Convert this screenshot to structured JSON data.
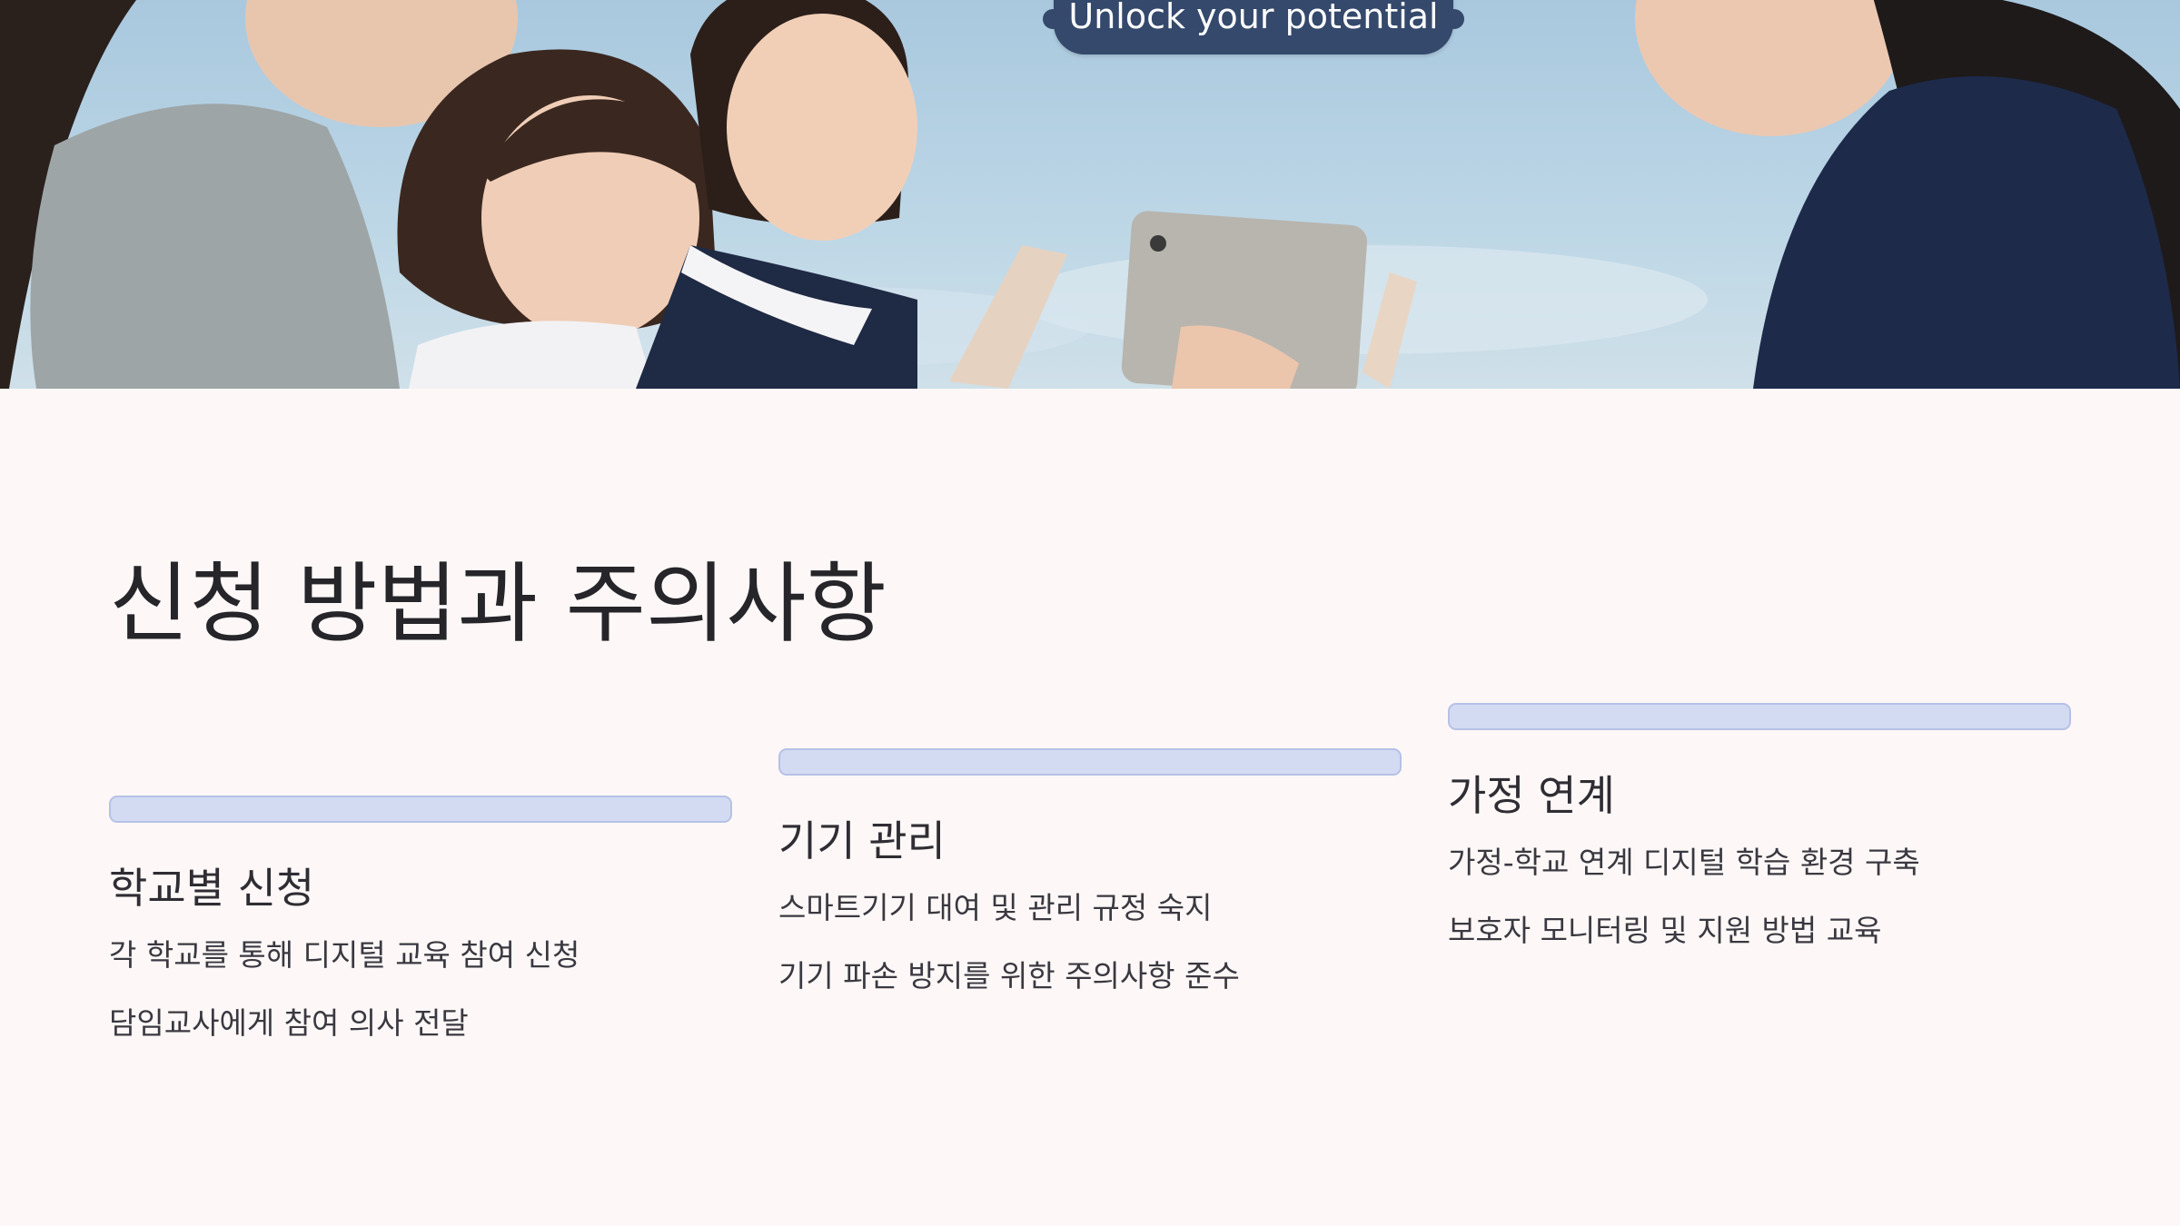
{
  "hero": {
    "badge_text": "Unlock your potential"
  },
  "slide": {
    "title": "신청 방법과 주의사항"
  },
  "cards": [
    {
      "heading": "학교별 신청",
      "lines": [
        "각 학교를 통해 디지털 교육 참여 신청",
        "담임교사에게 참여 의사 전달"
      ]
    },
    {
      "heading": "기기 관리",
      "lines": [
        "스마트기기 대여 및 관리 규정 숙지",
        "기기 파손 방지를 위한 주의사항 준수"
      ]
    },
    {
      "heading": "가정 연계",
      "lines": [
        "가정-학교 연계 디지털 학습 환경 구축",
        "보호자 모니터링 및 지원 방법 교육"
      ]
    }
  ],
  "colors": {
    "background": "#fdf8f7",
    "accent_bar": "#d3dbf3",
    "badge": "#34496b",
    "text": "#2b2a2e"
  }
}
